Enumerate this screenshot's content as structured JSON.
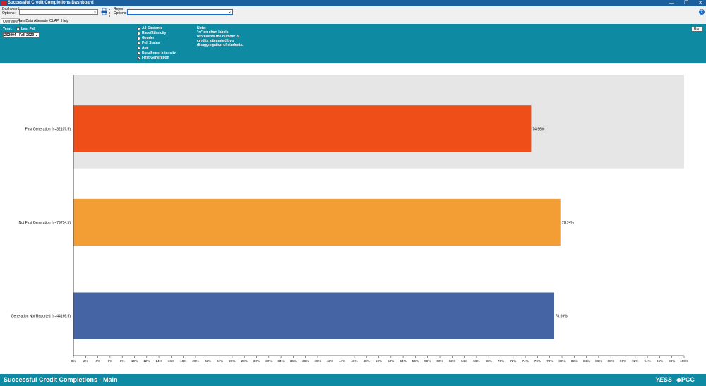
{
  "window": {
    "title": "Successful Credit Completions Dashboard",
    "minimize": "—",
    "restore": "❐",
    "close": "✕"
  },
  "toolbar": {
    "dashboard_options_label_1": "Dashboard",
    "dashboard_options_label_2": "Options:",
    "dashboard_options_value": "",
    "report_options_label_1": "Report",
    "report_options_label_2": "Options:",
    "report_options_value": "",
    "help": "?"
  },
  "tabs": [
    {
      "label": "Overview"
    },
    {
      "label": "Raw Data"
    },
    {
      "label": "Alternate"
    },
    {
      "label": "OLAP"
    },
    {
      "label": "Help"
    }
  ],
  "filters": {
    "term_label": "Term:",
    "last_fall_label": "Last Fall",
    "last_fall_checked": true,
    "term_value": "202004 - Fall 2020",
    "breakdowns": [
      {
        "label": "All Students",
        "selected": false
      },
      {
        "label": "Race/Ethnicity",
        "selected": false
      },
      {
        "label": "Gender",
        "selected": false
      },
      {
        "label": "Pell Status",
        "selected": false
      },
      {
        "label": "Age",
        "selected": false
      },
      {
        "label": "Enrollment Intensity",
        "selected": false
      },
      {
        "label": "First Generation",
        "selected": true
      }
    ],
    "note_title": "Note:",
    "note_text": "\"n\" on chart labels represents the number of credits attempted by a disaggregation of students.",
    "run_label": "Run"
  },
  "chart_data": {
    "type": "bar",
    "orientation": "horizontal",
    "categories": [
      "First Generation (n=32107.5)",
      "Not First Generation (n=79714.5)",
      "Generation Not Reported (n=44166.5)"
    ],
    "values": [
      74.96,
      79.74,
      78.69
    ],
    "value_labels": [
      "74.96%",
      "79.74%",
      "78.69%"
    ],
    "colors": [
      "#f04e18",
      "#f29e35",
      "#4564a4"
    ],
    "background_bar": {
      "category_index": 0,
      "value": 100,
      "color": "#e6e6e6"
    },
    "xlim": [
      0,
      100
    ],
    "xticks": [
      0,
      2,
      4,
      6,
      8,
      10,
      12,
      14,
      16,
      18,
      20,
      22,
      24,
      26,
      28,
      30,
      32,
      34,
      36,
      38,
      40,
      42,
      44,
      46,
      48,
      50,
      52,
      54,
      56,
      58,
      60,
      62,
      64,
      66,
      68,
      70,
      72,
      74,
      76,
      78,
      80,
      82,
      84,
      86,
      88,
      90,
      92,
      94,
      96,
      98,
      100
    ],
    "tick_suffix": "%",
    "grid": false
  },
  "footer": {
    "title": "Successful Credit Completions - Main",
    "logo_yess": "YESS",
    "logo_pcc": "◈PCC"
  },
  "colors": {
    "title_bar": "#1c5f9e",
    "panel": "#0e8aa3",
    "footer": "#0e8aa3"
  }
}
